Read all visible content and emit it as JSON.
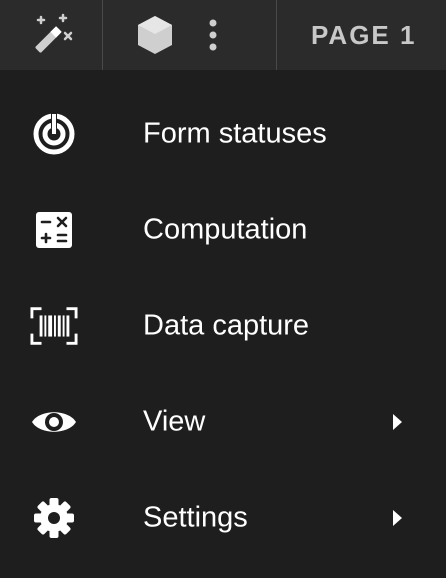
{
  "toolbar": {
    "page_label": "PAGE 1",
    "icons": [
      "magic-wand-icon",
      "cube-icon",
      "more-vertical-icon"
    ]
  },
  "menu": {
    "items": [
      {
        "label": "Form statuses",
        "icon": "form-status-icon",
        "has_submenu": false
      },
      {
        "label": "Computation",
        "icon": "calculator-icon",
        "has_submenu": false
      },
      {
        "label": "Data capture",
        "icon": "barcode-scan-icon",
        "has_submenu": false
      },
      {
        "label": "View",
        "icon": "eye-icon",
        "has_submenu": true
      },
      {
        "label": "Settings",
        "icon": "gear-icon",
        "has_submenu": true
      }
    ]
  },
  "colors": {
    "toolbar_bg": "#2b2b2b",
    "menu_bg": "#1e1e1e",
    "text": "#ffffff",
    "toolbar_text": "#c8c8c8"
  }
}
